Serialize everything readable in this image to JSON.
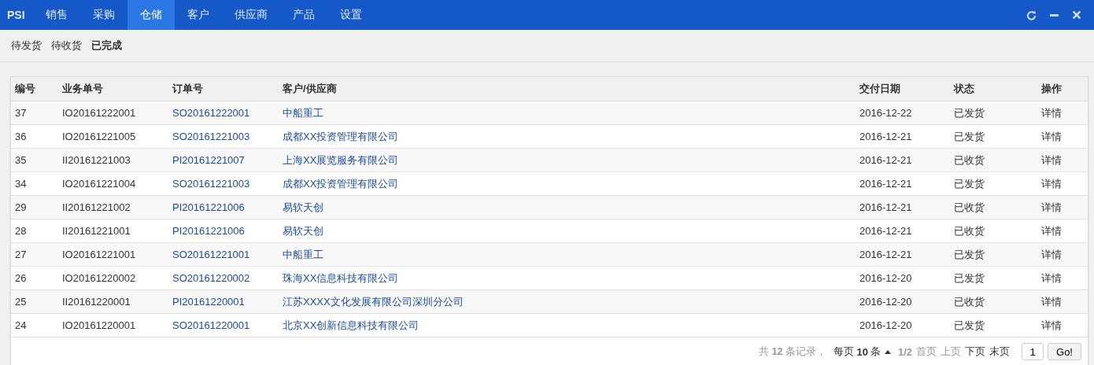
{
  "navbar": {
    "brand": "PSI",
    "items": [
      {
        "label": "销售",
        "selected": false
      },
      {
        "label": "采购",
        "selected": false
      },
      {
        "label": "仓储",
        "selected": true
      },
      {
        "label": "客户",
        "selected": false
      },
      {
        "label": "供应商",
        "selected": false
      },
      {
        "label": "产品",
        "selected": false
      },
      {
        "label": "设置",
        "selected": false
      }
    ]
  },
  "subtabs": [
    {
      "label": "待发货",
      "selected": false
    },
    {
      "label": "待收货",
      "selected": false
    },
    {
      "label": "已完成",
      "selected": true
    }
  ],
  "table": {
    "columns": [
      "编号",
      "业务单号",
      "订单号",
      "客户/供应商",
      "交付日期",
      "状态",
      "操作"
    ],
    "rows": [
      {
        "id": "37",
        "business_no": "IO20161222001",
        "order_no": "SO20161222001",
        "party": "中船重工",
        "date": "2016-12-22",
        "status": "已发货",
        "action": "详情"
      },
      {
        "id": "36",
        "business_no": "IO20161221005",
        "order_no": "SO20161221003",
        "party": "成都XX投资管理有限公司",
        "date": "2016-12-21",
        "status": "已发货",
        "action": "详情"
      },
      {
        "id": "35",
        "business_no": "II20161221003",
        "order_no": "PI20161221007",
        "party": "上海XX展览服务有限公司",
        "date": "2016-12-21",
        "status": "已收货",
        "action": "详情"
      },
      {
        "id": "34",
        "business_no": "IO20161221004",
        "order_no": "SO20161221003",
        "party": "成都XX投资管理有限公司",
        "date": "2016-12-21",
        "status": "已发货",
        "action": "详情"
      },
      {
        "id": "29",
        "business_no": "II20161221002",
        "order_no": "PI20161221006",
        "party": "易软天创",
        "date": "2016-12-21",
        "status": "已收货",
        "action": "详情"
      },
      {
        "id": "28",
        "business_no": "II20161221001",
        "order_no": "PI20161221006",
        "party": "易软天创",
        "date": "2016-12-21",
        "status": "已收货",
        "action": "详情"
      },
      {
        "id": "27",
        "business_no": "IO20161221001",
        "order_no": "SO20161221001",
        "party": "中船重工",
        "date": "2016-12-21",
        "status": "已发货",
        "action": "详情"
      },
      {
        "id": "26",
        "business_no": "IO20161220002",
        "order_no": "SO20161220002",
        "party": "珠海XX信息科技有限公司",
        "date": "2016-12-20",
        "status": "已发货",
        "action": "详情"
      },
      {
        "id": "25",
        "business_no": "II20161220001",
        "order_no": "PI20161220001",
        "party": "江苏XXXX文化发展有限公司深圳分公司",
        "date": "2016-12-20",
        "status": "已收货",
        "action": "详情"
      },
      {
        "id": "24",
        "business_no": "IO20161220001",
        "order_no": "SO20161220001",
        "party": "北京XX创新信息科技有限公司",
        "date": "2016-12-20",
        "status": "已发货",
        "action": "详情"
      }
    ]
  },
  "pagination": {
    "total_text": "共 **12** 条记录，",
    "page_size_text": "每页 **10** 条",
    "page_info": "1/2",
    "links": [
      {
        "label": "首页",
        "disabled": true
      },
      {
        "label": "上页",
        "disabled": true
      },
      {
        "label": "下页",
        "disabled": false
      },
      {
        "label": "末页",
        "disabled": false
      }
    ],
    "page_input": "1",
    "go_button": "Go!"
  }
}
